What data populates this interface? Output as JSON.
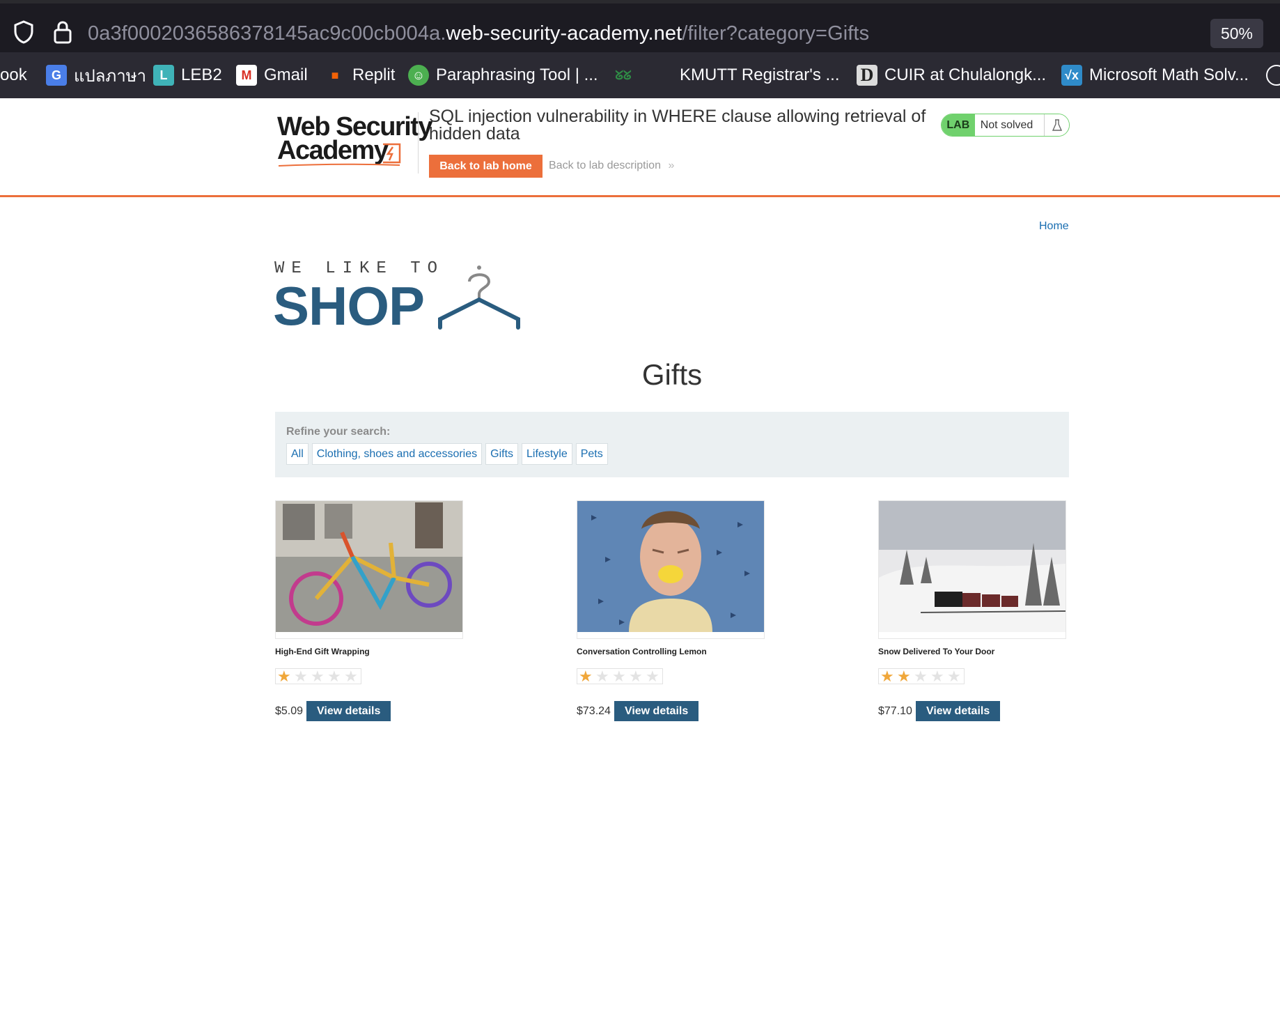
{
  "browser": {
    "url_prefix": "0a3f0002036586378145ac9c00cb004a.",
    "url_host": "web-security-academy.net",
    "url_path": "/filter?category=Gifts",
    "zoom": "50%",
    "bookmarks": [
      {
        "label": "ook",
        "icon": "book-icon"
      },
      {
        "label": "แปลภาษา",
        "icon": "google-translate-icon"
      },
      {
        "label": "LEB2",
        "icon": "leb2-icon"
      },
      {
        "label": "Gmail",
        "icon": "gmail-icon"
      },
      {
        "label": "Replit",
        "icon": "replit-icon"
      },
      {
        "label": "Paraphrasing Tool | ...",
        "icon": "paraphrasing-tool-icon"
      },
      {
        "label": "",
        "icon": "geeksforgeeks-icon"
      },
      {
        "label": "KMUTT Registrar's ...",
        "icon": "microsoft-icon"
      },
      {
        "label": "CUIR at Chulalongk...",
        "icon": "dspace-icon"
      },
      {
        "label": "Microsoft Math Solv...",
        "icon": "math-solver-icon"
      },
      {
        "label": "",
        "icon": "globe-icon"
      }
    ]
  },
  "lab_header": {
    "logo_line1": "Web Security",
    "logo_line2": "Academy",
    "title": "SQL injection vulnerability in WHERE clause allowing retrieval of hidden data",
    "back_home_label": "Back to lab home",
    "back_description_label": "Back to lab description",
    "status_tag": "LAB",
    "status_text": "Not solved",
    "accent_color": "#ec6f3b",
    "status_color": "#70d16d"
  },
  "shop": {
    "home_label": "Home",
    "logo_tagline": "WE LIKE TO",
    "logo_word": "SHOP",
    "heading": "Gifts",
    "refine_label": "Refine your search:",
    "categories": [
      "All",
      "Clothing, shoes and accessories",
      "Gifts",
      "Lifestyle",
      "Pets"
    ],
    "products": [
      {
        "name": "High-End Gift Wrapping",
        "rating": 1,
        "max_rating": 5,
        "price": "$5.09",
        "button": "View details"
      },
      {
        "name": "Conversation Controlling Lemon",
        "rating": 1,
        "max_rating": 5,
        "price": "$73.24",
        "button": "View details"
      },
      {
        "name": "Snow Delivered To Your Door",
        "rating": 2,
        "max_rating": 5,
        "price": "$77.10",
        "button": "View details"
      }
    ],
    "brand_color": "#2a5c7f",
    "link_color": "#1a6eb1"
  }
}
